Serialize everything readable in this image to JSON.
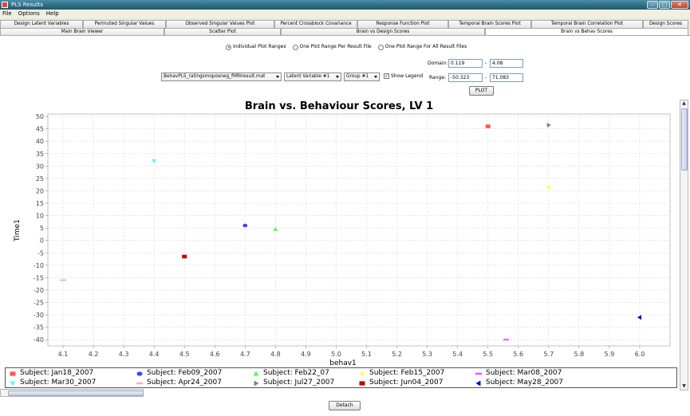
{
  "window": {
    "title": "PLS Results"
  },
  "menu": [
    "File",
    "Options",
    "Help"
  ],
  "tabs_row1": [
    "Design Latent Variables",
    "Permuted Singular Values",
    "Observed Singular Values Plot",
    "Percent Crossblock Covariance",
    "Response Function Plot",
    "Temporal Brain Scores Plot",
    "Temporal Brain Correlation Plot",
    "Design Scores"
  ],
  "tabs_row2": [
    "Main Brain Viewer",
    "Scatter Plot",
    "Brain vs Design Scores",
    "Brain vs Behav Scores"
  ],
  "active_tab": "Brain vs Behav Scores",
  "plot_range_options": [
    {
      "label": "Individual Plot Ranges",
      "selected": true
    },
    {
      "label": "One Plot Range Per Result File",
      "selected": false
    },
    {
      "label": "One Plot Range For All Result Files",
      "selected": false
    }
  ],
  "controls": {
    "file_select": "BehavPLS_ratingsmoposneg_fMRIresult.mat",
    "lv_select": "Latent Variable #1",
    "group_select": "Group #1",
    "show_legend_label": "Show Legend",
    "show_legend": true,
    "domain_label": "Domain:",
    "domain_min": "0.119",
    "domain_max": "4.08",
    "range_label": "Range:",
    "range_min": "-50.323",
    "range_max": "71.083",
    "dash": "-",
    "plot_button": "PLOT"
  },
  "detach_button": "Detach",
  "chart_data": {
    "type": "scatter",
    "title": "Brain vs. Behaviour Scores, LV 1",
    "xlabel": "behav1",
    "ylabel": "Time1",
    "xlim": [
      4.05,
      6.1
    ],
    "ylim": [
      -42.5,
      51
    ],
    "xticks": [
      4.1,
      4.2,
      4.3,
      4.4,
      4.5,
      4.6,
      4.7,
      4.8,
      4.9,
      5.0,
      5.1,
      5.2,
      5.3,
      5.4,
      5.5,
      5.6,
      5.7,
      5.8,
      5.9,
      6.0
    ],
    "xtick_labels": [
      "4.1",
      "4.2",
      "4.3",
      "4.4",
      "4.5",
      "4.6",
      "4.7",
      "4.8",
      "4.9",
      "5.0",
      "5.1",
      "5.2",
      "5.3",
      "5.4",
      "5.5",
      "5.6",
      "5.7",
      "5.8",
      "5.9",
      "6.0"
    ],
    "yticks": [
      -40,
      -35,
      -30,
      -25,
      -20,
      -15,
      -10,
      -5,
      0,
      5,
      10,
      15,
      20,
      25,
      30,
      35,
      40,
      45,
      50
    ],
    "grid": true,
    "legend_position": "bottom",
    "series": [
      {
        "name": "Subject: Jan18_2007",
        "color": "#ff5555",
        "shape": "square",
        "x": 5.5,
        "y": 46
      },
      {
        "name": "Subject: Feb09_2007",
        "color": "#4040ff",
        "shape": "circle",
        "x": 4.7,
        "y": 6
      },
      {
        "name": "Subject: Feb22_07",
        "color": "#55ff55",
        "shape": "triangle-up",
        "x": 4.8,
        "y": 4.5
      },
      {
        "name": "Subject: Feb15_2007",
        "color": "#ffff55",
        "shape": "diamond",
        "x": 5.7,
        "y": 21.5
      },
      {
        "name": "Subject: Mar08_2007",
        "color": "#ff55ff",
        "shape": "hbar",
        "x": 5.56,
        "y": -40
      },
      {
        "name": "Subject: Mar30_2007",
        "color": "#55ffff",
        "shape": "triangle-down",
        "x": 4.4,
        "y": 32
      },
      {
        "name": "Subject: Apr24_2007",
        "color": "#ffafaf",
        "shape": "hbar",
        "x": 4.1,
        "y": -16
      },
      {
        "name": "Subject: Jul27_2007",
        "color": "#808080",
        "shape": "triangle-right",
        "x": 5.7,
        "y": 46.5
      },
      {
        "name": "Subject: Jun04_2007",
        "color": "#c00000",
        "shape": "square",
        "x": 4.5,
        "y": -6.5
      },
      {
        "name": "Subject: May28_2007",
        "color": "#0000c0",
        "shape": "triangle-left",
        "x": 6.0,
        "y": -31
      }
    ]
  }
}
